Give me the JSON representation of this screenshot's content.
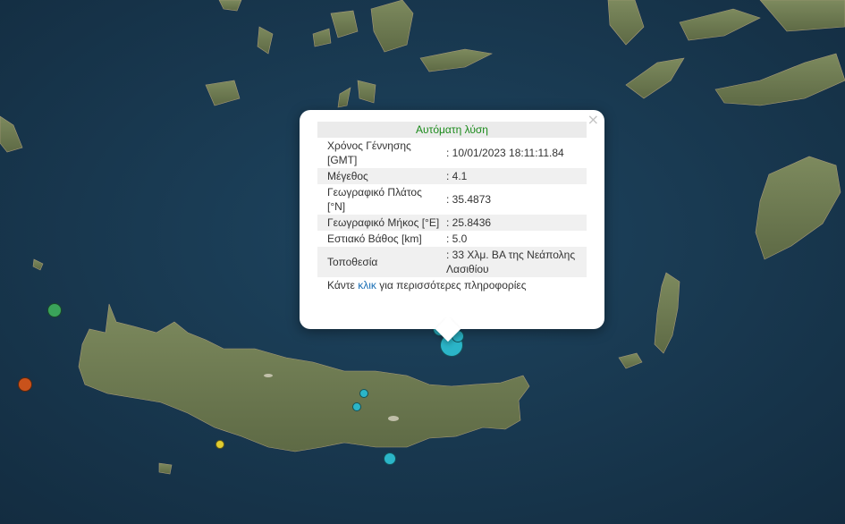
{
  "popup": {
    "title": "Αυτόματη λύση",
    "close_glyph": "×",
    "rows": [
      {
        "label": "Χρόνος Γέννησης [GMT]",
        "value": ": 10/01/2023 18:11:11.84"
      },
      {
        "label": "Μέγεθος",
        "value": ": 4.1"
      },
      {
        "label": "Γεωγραφικό Πλάτος [°N]",
        "value": ": 35.4873"
      },
      {
        "label": "Γεωγραφικό Μήκος [°E]",
        "value": ": 25.8436"
      },
      {
        "label": "Εστιακό Βάθος [km]",
        "value": ": 5.0"
      },
      {
        "label": "Τοποθεσία",
        "value": ": 33 Χλμ. ΒΑ της Νεάπολης Λασιθίου"
      }
    ],
    "more_prefix": "Κάντε ",
    "more_link": "κλικ",
    "more_suffix": " για περισσότερες πληροφορίες"
  },
  "colors": {
    "sea": "#1a3a52",
    "land": "#6e7a52",
    "marker_green": "#3aa35a",
    "marker_orange": "#c9521b",
    "marker_yellow": "#e0cc30",
    "marker_cyan": "#2bb5c8"
  }
}
